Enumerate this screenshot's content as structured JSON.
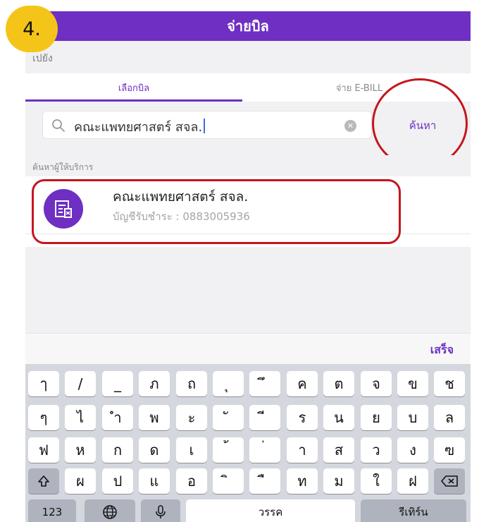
{
  "step_badge": "4.",
  "header": {
    "title": "จ่ายบิล"
  },
  "subbar": {
    "label": "เปยัง"
  },
  "tabs": [
    {
      "label": "เลือกบิล",
      "active": true
    },
    {
      "label": "จ่าย E-BILL",
      "active": false
    }
  ],
  "search": {
    "value": "คณะแพทยศาสตร์ สจล.",
    "button_label": "ค้นหา",
    "icon": "search-icon"
  },
  "section": {
    "label": "ค้นหาผู้ให้บริการ"
  },
  "result": {
    "name": "คณะแพทยศาสตร์ สจล.",
    "account": "บัญชีรับชำระ : 0883005936",
    "icon": "bill-provider-icon"
  },
  "keyboard": {
    "done_label": "เสร็จ",
    "row1": [
      "ๅ",
      "/",
      "_",
      "ภ",
      "ถ",
      "ุ",
      "ึ",
      "ค",
      "ต",
      "จ",
      "ข",
      "ช"
    ],
    "row2": [
      "ๆ",
      "ไ",
      "ำ",
      "พ",
      "ะ",
      "ั",
      "ี",
      "ร",
      "น",
      "ย",
      "บ",
      "ล"
    ],
    "row3": [
      "ฟ",
      "ห",
      "ก",
      "ด",
      "เ",
      "้",
      "่",
      "า",
      "ส",
      "ว",
      "ง",
      "ฃ"
    ],
    "row4": [
      "ผ",
      "ป",
      "แ",
      "อ",
      "ิ",
      "ื",
      "ท",
      "ม",
      "ใ",
      "ฝ"
    ],
    "numbers_label": "123",
    "space_label": "วรรค",
    "return_label": "รีเทิร์น"
  },
  "colors": {
    "accent": "#6f2fc2",
    "highlight": "#c4161c",
    "badge": "#f4c518"
  }
}
